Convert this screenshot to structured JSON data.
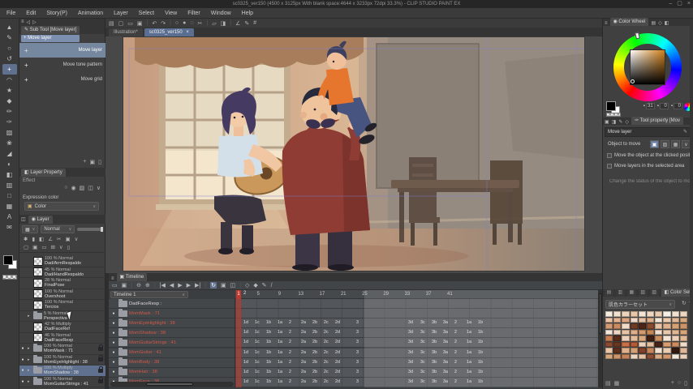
{
  "window": {
    "title": "sc0325_ver150 (4500 x 3125px With blank space:4644 x 3233px 72dpi 33.3%) - CLIP STUDIO PAINT EX",
    "controls": [
      {
        "name": "minimize",
        "glyph": "–"
      },
      {
        "name": "maximize",
        "glyph": "▢"
      },
      {
        "name": "close",
        "glyph": "×"
      }
    ]
  },
  "menu": {
    "items": [
      "File",
      "Edit",
      "Story(P)",
      "Animation",
      "Layer",
      "Select",
      "View",
      "Filter",
      "Window",
      "Help"
    ]
  },
  "tool_strip": {
    "tools": [
      {
        "name": "operation-tool",
        "glyph": "▲"
      },
      {
        "name": "pen-tool",
        "glyph": "✎"
      },
      {
        "name": "zoom-tool",
        "glyph": "○"
      },
      {
        "name": "rotate-canvas-tool",
        "glyph": "↺"
      },
      {
        "name": "move-layer-tool",
        "glyph": "+",
        "selected": true
      },
      {
        "name": "lasso-tool",
        "glyph": "◠"
      },
      {
        "name": "auto-select-tool",
        "glyph": "★"
      },
      {
        "name": "eyedropper-tool",
        "glyph": "◆"
      },
      {
        "name": "pencil-tool",
        "glyph": "✏"
      },
      {
        "name": "brush-tool",
        "glyph": "✑"
      },
      {
        "name": "airbrush-tool",
        "glyph": "▨"
      },
      {
        "name": "decoration-tool",
        "glyph": "❀"
      },
      {
        "name": "eraser-tool",
        "glyph": "◢"
      },
      {
        "name": "blend-tool",
        "glyph": "◐"
      },
      {
        "name": "fill-tool",
        "glyph": "◧"
      },
      {
        "name": "gradient-tool",
        "glyph": "▥"
      },
      {
        "name": "figure-tool",
        "glyph": "□"
      },
      {
        "name": "frame-border-tool",
        "glyph": "▦"
      },
      {
        "name": "text-tool",
        "glyph": "A"
      },
      {
        "name": "balloon-tool",
        "glyph": "✉"
      }
    ]
  },
  "sub_tool": {
    "tab": "Sub Tool [Move layer]",
    "current": "Move layer",
    "items": [
      {
        "label": "Move layer",
        "selected": true
      },
      {
        "label": "Move tone pattern",
        "selected": false
      },
      {
        "label": "Move grid",
        "selected": false
      }
    ],
    "footer_icons": [
      {
        "name": "add-subtool",
        "glyph": "+"
      },
      {
        "name": "duplicate-subtool",
        "glyph": "▣"
      },
      {
        "name": "delete-subtool",
        "glyph": "▯"
      }
    ]
  },
  "layer_property": {
    "tab": "Layer Property",
    "effect_label": "Effect",
    "effect_icons": [
      {
        "name": "border-effect",
        "glyph": "○"
      },
      {
        "name": "tone-effect",
        "glyph": "◉"
      },
      {
        "name": "extract-line-effect",
        "glyph": "▨"
      },
      {
        "name": "layer-color-effect",
        "glyph": "◫"
      },
      {
        "name": "effect-expand",
        "glyph": "∨"
      }
    ],
    "expression_label": "Expression color",
    "expression_value": "Color"
  },
  "layer_panel": {
    "tab": "Layer",
    "blend_mode": "Normal",
    "header_icons_row1": [
      {
        "name": "lock-transparent-pixels",
        "glyph": "✱"
      },
      {
        "name": "lock-layer",
        "glyph": "▮"
      },
      {
        "name": "clip-to-layer-below",
        "glyph": "◧"
      },
      {
        "name": "set-as-ruler",
        "glyph": "∠"
      },
      {
        "name": "mask",
        "glyph": "✂"
      },
      {
        "name": "layer-color",
        "glyph": "▣"
      },
      {
        "name": "more",
        "glyph": "∨"
      }
    ],
    "header_icons_row2": [
      {
        "name": "new-raster-layer",
        "glyph": "▢"
      },
      {
        "name": "new-vector-layer",
        "glyph": "▣"
      },
      {
        "name": "new-folder",
        "glyph": "▭"
      },
      {
        "name": "transfer-layer",
        "glyph": "⊞"
      },
      {
        "name": "merge-down",
        "glyph": "∨"
      },
      {
        "name": "delete-layer",
        "glyph": "▯"
      }
    ],
    "layers": [
      {
        "opacity": "100 %",
        "mode": "Normal",
        "name": "Dad/ArmRespaldo",
        "kind": "cel"
      },
      {
        "opacity": "45 %",
        "mode": "Normal",
        "name": "Dad/HandRespaldo",
        "kind": "cel"
      },
      {
        "opacity": "28 %",
        "mode": "Normal",
        "name": "FinalPose",
        "kind": "cel"
      },
      {
        "opacity": "100 %",
        "mode": "Normal",
        "name": "Overshoot",
        "kind": "cel"
      },
      {
        "opacity": "100 %",
        "mode": "Normal",
        "name": "Tercios",
        "kind": "cel"
      },
      {
        "opacity": "5 %",
        "mode": "Normal",
        "name": "Perspectiva",
        "kind": "folder"
      },
      {
        "opacity": "42 %",
        "mode": "Multiply",
        "name": "DadFaceRef",
        "kind": "cel"
      },
      {
        "opacity": "46 %",
        "mode": "Normal",
        "name": "DadFaceResp",
        "kind": "cel"
      },
      {
        "opacity": "100 %",
        "mode": "Normal",
        "name": "MomMask : 71",
        "kind": "folder",
        "eye": true,
        "lock": true
      },
      {
        "opacity": "100 %",
        "mode": "Normal",
        "name": "MomEyeHighlight : 38",
        "kind": "folder",
        "eye": true,
        "lock": true
      },
      {
        "opacity": "100 %",
        "mode": "Multiply",
        "name": "MomShadow : 38",
        "kind": "folder",
        "eye": true,
        "lock": true,
        "selected": true
      },
      {
        "opacity": "100 %",
        "mode": "Normal",
        "name": "MomGuitarStrings : 41",
        "kind": "folder",
        "eye": true,
        "lock": true
      }
    ]
  },
  "command_bar": {
    "icons": [
      {
        "name": "main-menu",
        "glyph": "▤"
      },
      {
        "name": "new-file",
        "glyph": "▢"
      },
      {
        "name": "open-file",
        "glyph": "▭"
      },
      {
        "name": "save-file",
        "glyph": "▣"
      },
      {
        "name": "undo",
        "glyph": "↶"
      },
      {
        "name": "redo",
        "glyph": "↷"
      },
      {
        "name": "deselect",
        "glyph": "○"
      },
      {
        "name": "reselect",
        "glyph": "●"
      },
      {
        "name": "invert-selection",
        "glyph": "◌"
      },
      {
        "name": "crop",
        "glyph": "✂"
      },
      {
        "name": "transform",
        "glyph": "▱"
      },
      {
        "name": "fill",
        "glyph": "◨"
      },
      {
        "name": "snap-to-ruler",
        "glyph": "∠"
      },
      {
        "name": "correct-line",
        "glyph": "✎"
      },
      {
        "name": "grid",
        "glyph": "#"
      }
    ]
  },
  "document_tabs": [
    {
      "label": "Illustration*",
      "active": false,
      "close": ""
    },
    {
      "label": "sc0325_ver150",
      "active": true,
      "close": "×"
    }
  ],
  "timeline": {
    "tab": "Timeline",
    "name": "Timeline 1",
    "toolbar": [
      {
        "name": "timeline-spec",
        "glyph": "▭"
      },
      {
        "name": "cel-spec",
        "glyph": "▣"
      },
      {
        "name": "zoom-out-timeline",
        "glyph": "⊖"
      },
      {
        "name": "zoom-in-timeline",
        "glyph": "⊕"
      },
      {
        "name": "go-to-start",
        "glyph": "|◀"
      },
      {
        "name": "prev-frame",
        "glyph": "◀"
      },
      {
        "name": "play",
        "glyph": "▶"
      },
      {
        "name": "next-frame",
        "glyph": "▶"
      },
      {
        "name": "go-to-end",
        "glyph": "▶|"
      },
      {
        "name": "loop-playback",
        "glyph": "↻",
        "active": true
      },
      {
        "name": "new-animation-cel",
        "glyph": "▣"
      },
      {
        "name": "onion-skin",
        "glyph": "◫"
      },
      {
        "name": "enable-keyframes",
        "glyph": "◇"
      },
      {
        "name": "add-keyframe",
        "glyph": "◆"
      },
      {
        "name": "edit-track",
        "glyph": "✎"
      },
      {
        "name": "normal-line",
        "glyph": "/"
      }
    ],
    "ruler_frames": [
      5,
      9,
      13,
      17,
      21,
      25,
      29,
      33,
      37,
      41
    ],
    "playhead_frame": "1",
    "end_marker": "2",
    "cel_labels": [
      "1d",
      "1c",
      "1b",
      "1a",
      "2",
      "2a",
      "2b",
      "2c",
      "2d",
      "3",
      "3d",
      "3c",
      "3b",
      "3a",
      "2",
      "1a",
      "1b"
    ],
    "cel_offsets": [
      10,
      24,
      38,
      52,
      66,
      81,
      95,
      109,
      123,
      149,
      213,
      228,
      242,
      256,
      270,
      285,
      299
    ],
    "tracks": [
      {
        "name": "DadFaceResp :",
        "red": false,
        "eye": false,
        "cels": false
      },
      {
        "name": "MomMask : 71",
        "red": true,
        "eye": true,
        "cels": false
      },
      {
        "name": "MomEyeHighlight : 38",
        "red": true,
        "eye": true,
        "cels": true
      },
      {
        "name": "MomShadow : 38",
        "red": true,
        "eye": true,
        "cels": true
      },
      {
        "name": "MomGuitarStrings : 41",
        "red": true,
        "eye": true,
        "cels": true
      },
      {
        "name": "MomGuitar : 41",
        "red": true,
        "eye": true,
        "cels": true
      },
      {
        "name": "MomBody : 38",
        "red": true,
        "eye": true,
        "cels": true
      },
      {
        "name": "MomHair : 38",
        "red": true,
        "eye": true,
        "cels": true
      },
      {
        "name": "MomFace : 38",
        "red": true,
        "eye": true,
        "cels": true
      }
    ]
  },
  "color_wheel": {
    "tab": "Color Wheel",
    "values": [
      "31",
      "0",
      "0"
    ],
    "foreground": "#000000",
    "background": "#ffffff"
  },
  "tool_property": {
    "tab": "Tool property [Mov",
    "title": "Move layer",
    "object_label": "Object to move",
    "object_buttons": [
      {
        "name": "move-target-layer",
        "glyph": "▣",
        "active": true
      },
      {
        "name": "move-target-tone",
        "glyph": "▨",
        "active": false
      },
      {
        "name": "move-target-grid",
        "glyph": "▦",
        "active": false
      },
      {
        "name": "move-target-expand",
        "glyph": "∨",
        "active": false
      }
    ],
    "checkboxes": [
      "Move the object at the clicked position",
      "Move layers in the selected area"
    ],
    "hint": "Change the status of the object to move to selec"
  },
  "color_set": {
    "tab": "Color Set",
    "set_name": "肌色カラーセット",
    "swatches": [
      "#f6ecdf",
      "#f1e1cd",
      "#ecd3ba",
      "#e7c7a8",
      "#f3e5d6",
      "#eed8c2",
      "#e9cbb0",
      "#f6efe4",
      "#f1e2d0",
      "#ecd6bf",
      "#eac2a4",
      "#e2b292",
      "#d9a47f",
      "#f0d9c6",
      "#e7c1a4",
      "#ddae8a",
      "#f2e5d6",
      "#eacaae",
      "#e0b695",
      "#d7a87e",
      "#d19a72",
      "#c98b60",
      "#f0dcc9",
      "#6e3a24",
      "#4d2417",
      "#8a4a2e",
      "#e8c3a6",
      "#dfb291",
      "#d5a276",
      "#cc9468",
      "#f4e7d9",
      "#eed6c2",
      "#e6c3a4",
      "#dcae8b",
      "#d0996e",
      "#c58753",
      "#f1dfcd",
      "#e9c9ac",
      "#e0b692",
      "#d6a578",
      "#c77d52",
      "#5a2d1b",
      "#ecd0b9",
      "#e3bb9a",
      "#d8a97e",
      "#3f1f12",
      "#cd8f62",
      "#f3e4d4",
      "#eccfb6",
      "#e2b997",
      "#8c4a2f",
      "#6b3620",
      "#c96f45",
      "#b55a35",
      "#edd3bd",
      "#e5c0a0",
      "#4a2517",
      "#d99d6f",
      "#cf8b5b",
      "#f0dcc8",
      "#e9c6a8",
      "#5f2f1d",
      "#dfb28d",
      "#d4a176",
      "#80402a",
      "#c8845a",
      "#f2e2d1",
      "#eaccb1",
      "#34180e",
      "#e1b795",
      "#d8a87d",
      "#ce9668",
      "#c3835a",
      "#edd5c0",
      "#e5c2a3",
      "#8e4e33",
      "#dbab82",
      "#d1996d",
      "#f4e8da",
      "#ecd2ba"
    ]
  },
  "colors": {
    "selection_blue": "#7d8fae",
    "tab_active_blue": "#5a6e92",
    "playhead_red": "#b8372c",
    "timeline_red_text": "#d05848"
  }
}
